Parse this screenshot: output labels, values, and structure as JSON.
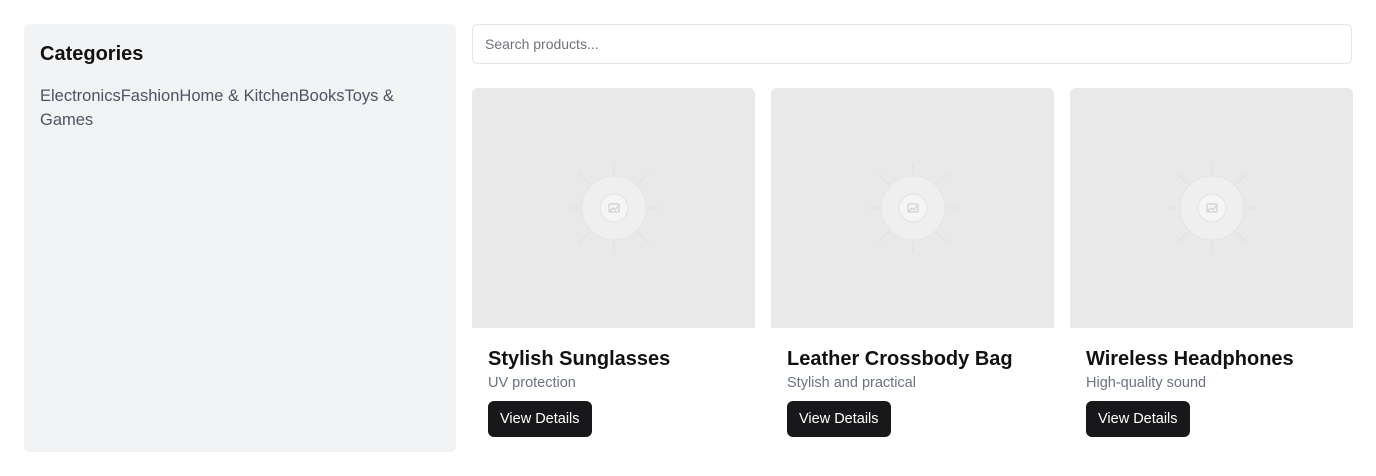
{
  "sidebar": {
    "title": "Categories",
    "categories": [
      "Electronics",
      "Fashion",
      "Home & Kitchen",
      "Books",
      "Toys & Games"
    ]
  },
  "search": {
    "placeholder": "Search products...",
    "value": ""
  },
  "products": [
    {
      "name": "Stylish Sunglasses",
      "description": "UV protection",
      "button_label": "View Details",
      "image_icon": "image-placeholder-icon"
    },
    {
      "name": "Leather Crossbody Bag",
      "description": "Stylish and practical",
      "button_label": "View Details",
      "image_icon": "image-placeholder-icon"
    },
    {
      "name": "Wireless Headphones",
      "description": "High-quality sound",
      "button_label": "View Details",
      "image_icon": "image-placeholder-icon"
    }
  ],
  "colors": {
    "sidebar_bg": "#f2f3f5",
    "image_placeholder_bg": "#e9e9e9",
    "button_bg": "#18181b",
    "button_text": "#ffffff",
    "muted_text": "#6b7280"
  }
}
